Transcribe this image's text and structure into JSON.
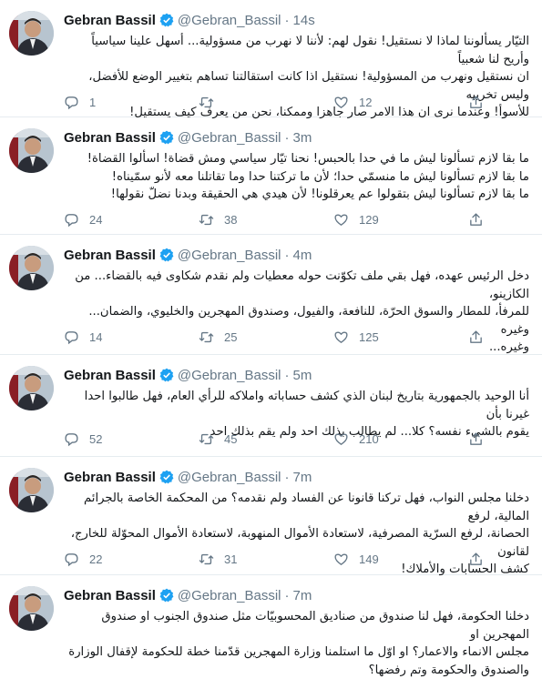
{
  "colors": {
    "name": "#14171a",
    "muted": "#657786",
    "verified": "#1da1f2",
    "divider": "#e6ecf0"
  },
  "icons": {
    "reply": "reply-icon",
    "retweet": "retweet-icon",
    "like": "heart-icon",
    "share": "share-icon",
    "verified": "verified-badge-icon"
  },
  "tweets": [
    {
      "name": "Gebran Bassil",
      "handle": "@Gebran_Bassil",
      "dot": "·",
      "time": "14s",
      "lines": [
        "التيّار يسألوننا لماذا لا نستقيل! نقول لهم: لأننا لا نهرب من مسؤولية... أسهل علينا سياسياً وأريح لنا شعبياً",
        "ان نستقيل ونهرب من المسؤولية! نستقيل اذا كانت استقالتنا تساهم بتغيير الوضع للأفضل، وليس تخريبه",
        "للأسوأ! وعندما نرى ان هذا الامر صار جاهزا وممكنا، نحن من يعرف كيف يستقيل!"
      ],
      "replies": "1",
      "retweets": "",
      "likes": "12"
    },
    {
      "name": "Gebran Bassil",
      "handle": "@Gebran_Bassil",
      "dot": "·",
      "time": "3m",
      "lines": [
        "ما بقا لازم تسألونا ليش ما في حدا بالحبس! نحنا تيّار سياسي ومش قضاة! اسألوا القضاة!",
        "ما بقا لازم تسألونا ليش ما منسمّي حدا؛ لأن ما تركتنا حدا وما تقاتلنا معه لأنو سمّيناه!",
        "ما بقا لازم تسألونا ليش بتقولوا عم يعرقلونا! لأن هيدي هي الحقيقة وبدنا نضلّ نقولها!"
      ],
      "replies": "24",
      "retweets": "38",
      "likes": "129"
    },
    {
      "name": "Gebran Bassil",
      "handle": "@Gebran_Bassil",
      "dot": "·",
      "time": "4m",
      "lines": [
        "دخل الرئيس عهده، فهل بقي ملف تكوّنت حوله معطيات ولم نقدم شكاوى فيه بالقضاء... من الكازينو،",
        "للمرفأ، للمطار والسوق الحرّة، للنافعة، والفيول، وصندوق المهجرين والخليوي، والضمان... وغيره",
        "وغيره..."
      ],
      "replies": "14",
      "retweets": "25",
      "likes": "125"
    },
    {
      "name": "Gebran Bassil",
      "handle": "@Gebran_Bassil",
      "dot": "·",
      "time": "5m",
      "lines": [
        "أنا الوحيد بالجمهورية بتاريخ لبنان الذي كشف حساباته واملاكه للرأي العام، فهل طالبوا احدا غيرنا بأن",
        "يقوم بالشيء نفسه؟ كلا... لم يطالب بذلك احد ولم يقم بذلك احد"
      ],
      "replies": "52",
      "retweets": "45",
      "likes": "210"
    },
    {
      "name": "Gebran Bassil",
      "handle": "@Gebran_Bassil",
      "dot": "·",
      "time": "7m",
      "lines": [
        "دخلنا مجلس النواب، فهل تركنا قانونا عن الفساد ولم نقدمه؟ من المحكمة الخاصة بالجرائم المالية، لرفع",
        "الحصانة، لرفع السرّية المصرفية، لاستعادة الأموال المنهوبة، لاستعادة الأموال المحوّلة للخارج، لقانون",
        "كشف الحسابات والأملاك!"
      ],
      "replies": "22",
      "retweets": "31",
      "likes": "149"
    },
    {
      "name": "Gebran Bassil",
      "handle": "@Gebran_Bassil",
      "dot": "·",
      "time": "7m",
      "lines": [
        "دخلنا الحكومة، فهل لنا صندوق من صناديق المحسوبيّات مثل صندوق الجنوب او صندوق المهجرين او",
        "مجلس الانماء والاعمار؟ او اوّل ما استلمنا وزارة المهجرين قدّمنا خطة للحكومة لإقفال الوزارة",
        "والصندوق والحكومة وتم رفضها؟"
      ],
      "replies": "",
      "retweets": "",
      "likes": ""
    }
  ]
}
